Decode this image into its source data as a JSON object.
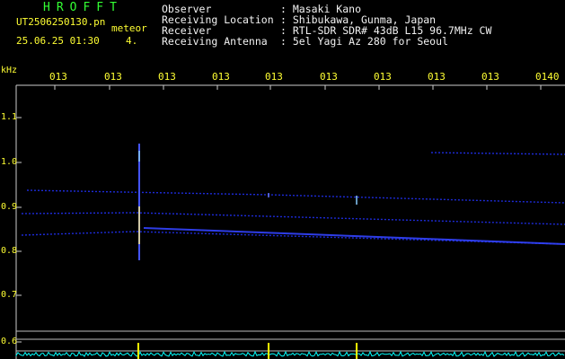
{
  "header": {
    "title": "HROFFT",
    "filename": "UT2506250130.pn",
    "meteor_label": "meteor",
    "datetime": "25.06.25 01:30",
    "count": "4.",
    "info": [
      {
        "label": "Observer",
        "value": ": Masaki Kano"
      },
      {
        "label": "Receiving Location",
        "value": ": Shibukawa, Gunma, Japan"
      },
      {
        "label": "Receiver",
        "value": ": RTL-SDR SDR# 43dB L15 96.7MHz CW"
      },
      {
        "label": "Receiving Antenna",
        "value": ": 5el Yagi Az 280 for Seoul"
      }
    ]
  },
  "axis": {
    "unit": "kHz",
    "y_ticks": [
      "1.1",
      "1.0",
      "0.9",
      "0.8",
      "0.7",
      "0.6"
    ],
    "x_ticks": [
      "013",
      "013",
      "013",
      "013",
      "013",
      "013",
      "013",
      "013",
      "013",
      "0140"
    ]
  },
  "colors": {
    "text_info": "#ffff33",
    "text_title": "#33ff33",
    "signal": "#2233ff",
    "trace": "#00ffff",
    "marker": "#ffff00"
  }
}
